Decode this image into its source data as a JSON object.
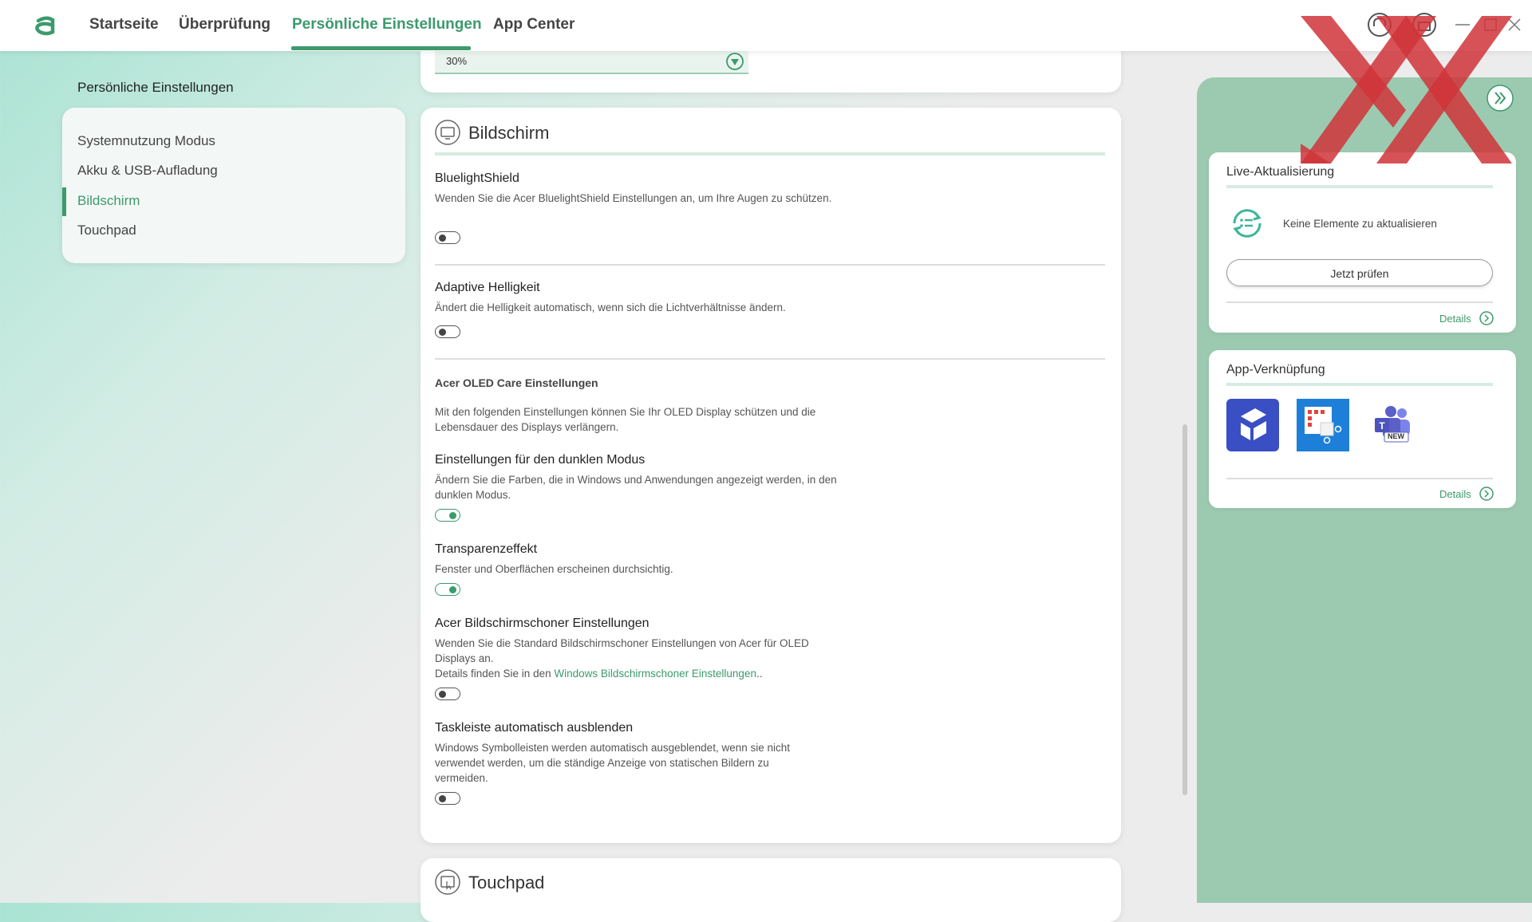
{
  "nav": {
    "tabs": [
      {
        "label": "Startseite"
      },
      {
        "label": "Überprüfung"
      },
      {
        "label": "Persönliche Einstellungen"
      },
      {
        "label": "App Center"
      }
    ],
    "active_tab": "Persönliche Einstellungen"
  },
  "sidebar": {
    "title": "Persönliche Einstellungen",
    "items": [
      {
        "label": "Systemnutzung Modus"
      },
      {
        "label": "Akku & USB-Aufladung"
      },
      {
        "label": "Bildschirm"
      },
      {
        "label": "Touchpad"
      }
    ],
    "active_item": "Bildschirm"
  },
  "previous_section": {
    "slider_value": "30%"
  },
  "display_section": {
    "title": "Bildschirm",
    "settings": {
      "bluelight": {
        "title": "BluelightShield",
        "desc": "Wenden Sie die Acer BluelightShield Einstellungen an, um Ihre Augen zu schützen.",
        "enabled": false
      },
      "adaptive": {
        "title": "Adaptive Helligkeit",
        "desc": "Ändert die Helligkeit automatisch, wenn sich die Lichtverhältnisse ändern.",
        "enabled": false
      },
      "oled_header": {
        "title": "Acer OLED Care Einstellungen",
        "desc": "Mit den folgenden Einstellungen können Sie Ihr OLED Display schützen und die Lebensdauer des Displays verlängern."
      },
      "dark_mode": {
        "title": "Einstellungen für den dunklen Modus",
        "desc": "Ändern Sie die Farben, die in Windows und Anwendungen angezeigt werden, in den dunklen Modus.",
        "enabled": true
      },
      "transparency": {
        "title": "Transparenzeffekt",
        "desc": "Fenster und Oberflächen erscheinen durchsichtig.",
        "enabled": true
      },
      "screensaver": {
        "title": "Acer Bildschirmschoner Einstellungen",
        "desc": "Wenden Sie die Standard Bildschirmschoner Einstellungen von Acer für OLED Displays an.",
        "desc2_prefix": "Details finden Sie in den ",
        "link": "Windows Bildschirmschoner Einstellungen",
        "desc2_suffix": "..",
        "enabled": false
      },
      "taskbar": {
        "title": "Taskleiste automatisch ausblenden",
        "desc": "Windows Symbolleisten werden automatisch ausgeblendet, wenn sie nicht verwendet werden, um die ständige Anzeige von statischen Bildern zu vermeiden.",
        "enabled": false
      }
    }
  },
  "touchpad_section": {
    "title": "Touchpad"
  },
  "right_panel": {
    "live_update": {
      "title": "Live-Aktualisierung",
      "status": "Keine Elemente zu aktualisieren",
      "button": "Jetzt prüfen",
      "details": "Details"
    },
    "app_shortcuts": {
      "title": "App-Verknüpfung",
      "apps": [
        {
          "name": "app-1-icon",
          "color": "#3a4fc4"
        },
        {
          "name": "app-2-icon",
          "color": "#1e7fd8"
        },
        {
          "name": "teams-icon",
          "color": "#5b5fc7",
          "badge": "NEW"
        }
      ],
      "details": "Details"
    }
  },
  "colors": {
    "accent": "#3c9a6d",
    "panel": "#9ccab1",
    "watermark": "#d0343a"
  }
}
